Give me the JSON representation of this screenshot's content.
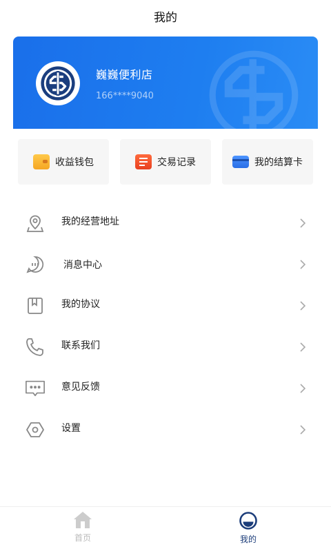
{
  "header": {
    "title": "我的"
  },
  "profile": {
    "store_name": "巍巍便利店",
    "phone": "166****9040"
  },
  "quick_actions": [
    {
      "label": "收益钱包",
      "icon": "wallet-icon",
      "color": "#f5a623"
    },
    {
      "label": "交易记录",
      "icon": "transaction-record-icon",
      "color": "#f04b2a"
    },
    {
      "label": "我的结算卡",
      "icon": "bank-card-icon",
      "color": "#2f7df5"
    }
  ],
  "menu": [
    {
      "label": "我的经营地址",
      "icon": "location-icon"
    },
    {
      "label": "消息中心",
      "icon": "message-icon"
    },
    {
      "label": "我的协议",
      "icon": "agreement-icon"
    },
    {
      "label": "联系我们",
      "icon": "phone-icon"
    },
    {
      "label": "意见反馈",
      "icon": "feedback-icon"
    },
    {
      "label": "设置",
      "icon": "settings-icon"
    }
  ],
  "tabs": [
    {
      "label": "首页",
      "icon": "home-icon",
      "active": false
    },
    {
      "label": "我的",
      "icon": "profile-icon",
      "active": true
    }
  ],
  "colors": {
    "primary": "#1a6fea",
    "active_tab": "#1c3d7a",
    "inactive_tab": "#bbbbbb",
    "icon_gray": "#888888"
  }
}
